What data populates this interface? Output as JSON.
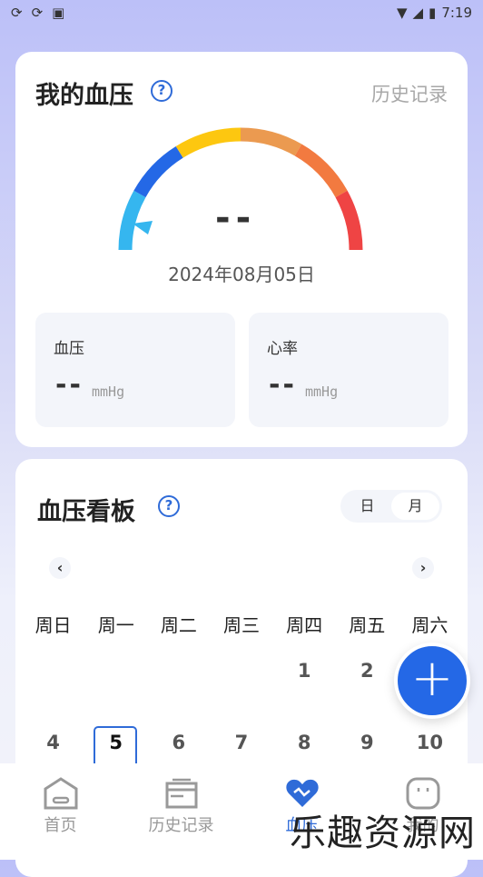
{
  "status_bar": {
    "time": "7:19",
    "icons": [
      "sync-icon",
      "sync-icon",
      "a-icon",
      "wifi-icon",
      "signal-icon",
      "battery-icon"
    ]
  },
  "bp_card": {
    "title": "我的血压",
    "help_icon": "?",
    "history_link": "历史记录",
    "gauge_value": "--",
    "date": "2024年08月05日",
    "gauge_colors": [
      "#35b6ef",
      "#2468e6",
      "#fdc710",
      "#eb9a50",
      "#f27a40",
      "#ef4444"
    ],
    "blood_pressure": {
      "label": "血压",
      "value": "--",
      "unit": "mmHg"
    },
    "heart_rate": {
      "label": "心率",
      "value": "--",
      "unit": "mmHg"
    }
  },
  "board": {
    "title": "血压看板",
    "help_icon": "?",
    "toggle": {
      "day": "日",
      "month": "月",
      "selected": "月"
    },
    "prev": "‹",
    "next": "›",
    "weekdays": [
      "周日",
      "周一",
      "周二",
      "周三",
      "周四",
      "周五",
      "周六"
    ],
    "rows": [
      [
        "",
        "",
        "",
        "",
        "1",
        "2",
        ""
      ],
      [
        "4",
        "5",
        "6",
        "7",
        "8",
        "9",
        "10"
      ]
    ],
    "selected_day": "5"
  },
  "fab": "+",
  "nav": [
    {
      "label": "首页",
      "icon": "home-icon"
    },
    {
      "label": "历史记录",
      "icon": "calendar-icon"
    },
    {
      "label": "血压",
      "icon": "heart-pulse-icon",
      "active": true
    },
    {
      "label": "我的",
      "icon": "profile-icon"
    }
  ],
  "watermark": "乐趣资源网",
  "accent": "#2f6bd8"
}
